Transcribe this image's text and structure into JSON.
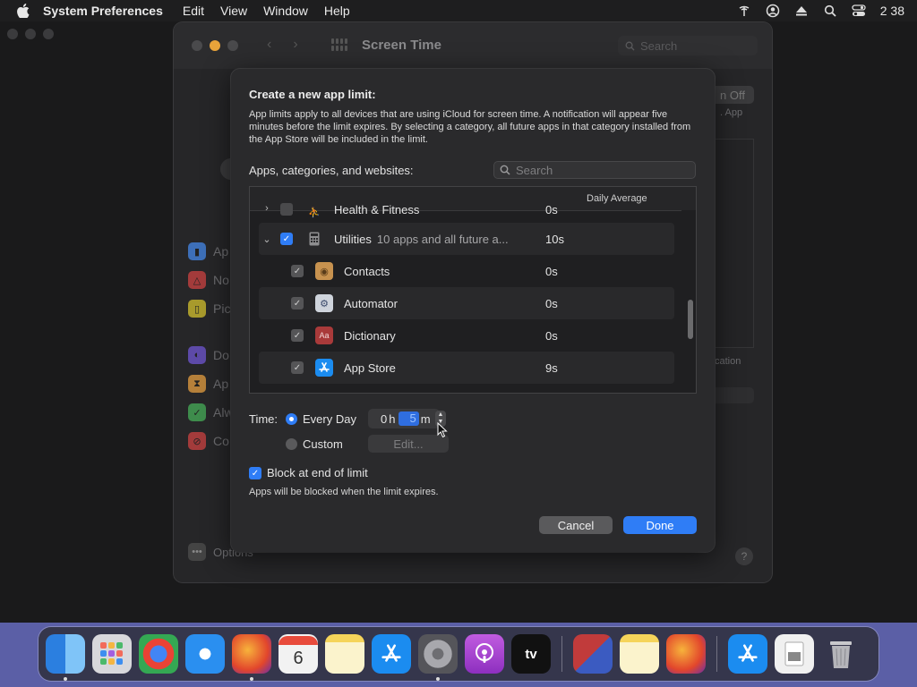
{
  "menubar": {
    "app_name": "System Preferences",
    "items": [
      "Edit",
      "View",
      "Window",
      "Help"
    ],
    "clock": "2 38"
  },
  "prefs_window": {
    "title": "Screen Time",
    "search_placeholder": "Search",
    "sidebar_items": [
      "Ap",
      "No",
      "Pic",
      "Do",
      "Ap",
      "Alw",
      "Co"
    ],
    "options_label": "Options",
    "right_button": "n Off",
    "right_text": ". App",
    "right_text2": "cation"
  },
  "sheet": {
    "title": "Create a new app limit:",
    "description": "App limits apply to all devices that are using iCloud for screen time. A notification will appear five minutes before the limit expires. By selecting a category, all future apps in that category installed from the App Store will be included in the limit.",
    "apps_label": "Apps, categories, and websites:",
    "search_placeholder": "Search",
    "table": {
      "column_daily": "Daily Average",
      "rows": [
        {
          "name": "Health & Fitness",
          "sub": "",
          "time": "0s",
          "type": "category",
          "expanded": false,
          "checked": false
        },
        {
          "name": "Utilities",
          "sub": "10 apps and all future a...",
          "time": "10s",
          "type": "category",
          "expanded": true,
          "checked": true
        },
        {
          "name": "Contacts",
          "sub": "",
          "time": "0s",
          "type": "app",
          "checked": true
        },
        {
          "name": "Automator",
          "sub": "",
          "time": "0s",
          "type": "app",
          "checked": true
        },
        {
          "name": "Dictionary",
          "sub": "",
          "time": "0s",
          "type": "app",
          "checked": true
        },
        {
          "name": "App Store",
          "sub": "",
          "time": "9s",
          "type": "app",
          "checked": true
        }
      ]
    },
    "time_label": "Time:",
    "every_day_label": "Every Day",
    "custom_label": "Custom",
    "hours_value": "0",
    "hours_unit": "h",
    "minutes_value": "5",
    "minutes_unit": "m",
    "edit_label": "Edit...",
    "block_label": "Block at end of limit",
    "block_checked": true,
    "block_desc": "Apps will be blocked when the limit expires.",
    "cancel_label": "Cancel",
    "done_label": "Done"
  },
  "colors": {
    "accent": "#2f7df6",
    "sheet_bg": "#2a2a2c",
    "dock_bg": "#5b5fa6"
  },
  "dock": {
    "apps": [
      "finder-icon",
      "launchpad-icon",
      "chrome-icon",
      "safari-icon",
      "firefox-icon",
      "calendar-icon",
      "notes-icon",
      "app-store-icon",
      "system-preferences-icon",
      "podcasts-icon",
      "apple-tv-icon",
      "parallels-icon",
      "notes-icon",
      "firefox-icon",
      "app-store-icon",
      "preview-icon",
      "trash-icon"
    ],
    "calendar_day": "6",
    "tv_label": "tv"
  }
}
